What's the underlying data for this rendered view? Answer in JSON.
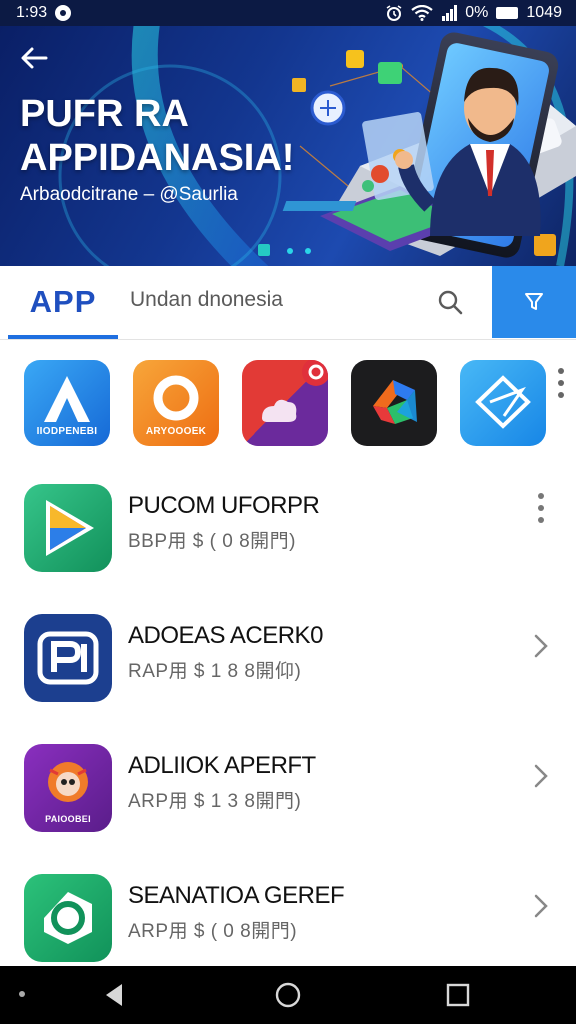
{
  "status_bar": {
    "time": "1:93",
    "right_text": "0%",
    "clock": "1049"
  },
  "banner": {
    "title_line1": "PUFR RA",
    "title_line2": "APPIDANASIA!",
    "subtitle": "Arbaodcitrane – @Saurlia"
  },
  "search": {
    "tab_label": "APP",
    "query": "Undan dnonesia"
  },
  "strip": {
    "items": [
      {
        "name": "app-a",
        "label": "IIODPENEBI",
        "color": "#1e88e5"
      },
      {
        "name": "app-o",
        "label": "ARYOOOEK",
        "color": "#f38a16"
      },
      {
        "name": "app-red-purple",
        "label": "",
        "color": "#7b2fa0"
      },
      {
        "name": "app-dark",
        "label": "",
        "color": "#1b1b1b"
      },
      {
        "name": "app-blue-diamond",
        "label": "",
        "color": "#1e9bf0"
      }
    ]
  },
  "list": {
    "items": [
      {
        "title": "PUCOM UFORPR",
        "subtitle": "BBP用 $ ( 0 8開門)",
        "trail": "more"
      },
      {
        "title": "ADOEAS ACERK0",
        "subtitle": "RAP用 $ 1 8 8開仰)",
        "trail": "chevron"
      },
      {
        "title": "ADLIIOK APERFT",
        "subtitle": "ARP用 $ 1 3 8開門)",
        "trail": "chevron"
      },
      {
        "title": "SEANATIOA GEREF",
        "subtitle": "ARP用 $ ( 0 8開門)",
        "trail": "chevron"
      }
    ],
    "card_label": "PAIOOBEI"
  }
}
